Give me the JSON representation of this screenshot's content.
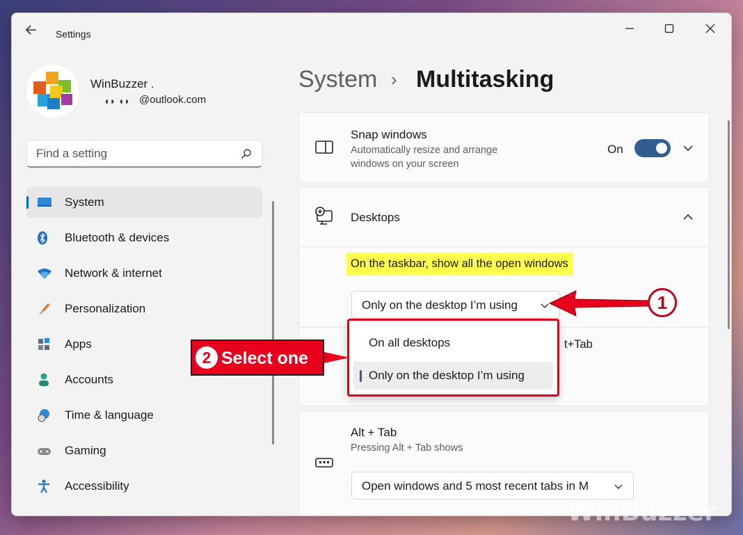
{
  "window": {
    "title": "Settings"
  },
  "user": {
    "name": "WinBuzzer .",
    "email_suffix": "@outlook.com"
  },
  "search": {
    "placeholder": "Find a setting"
  },
  "sidebar": {
    "items": [
      {
        "label": "System",
        "icon": "system-icon",
        "active": true
      },
      {
        "label": "Bluetooth & devices",
        "icon": "bluetooth-icon"
      },
      {
        "label": "Network & internet",
        "icon": "wifi-icon"
      },
      {
        "label": "Personalization",
        "icon": "brush-icon"
      },
      {
        "label": "Apps",
        "icon": "apps-icon"
      },
      {
        "label": "Accounts",
        "icon": "person-icon"
      },
      {
        "label": "Time & language",
        "icon": "clock-globe-icon"
      },
      {
        "label": "Gaming",
        "icon": "gamepad-icon"
      },
      {
        "label": "Accessibility",
        "icon": "accessibility-icon"
      }
    ]
  },
  "breadcrumb": {
    "parent": "System",
    "separator": "›",
    "current": "Multitasking"
  },
  "snap": {
    "title": "Snap windows",
    "desc_line1": "Automatically resize and arrange",
    "desc_line2": "windows on your screen",
    "toggle_label": "On",
    "toggle_on": true
  },
  "desktops": {
    "title": "Desktops",
    "setting_label": "On the taskbar, show all the open windows",
    "dropdown_value": "Only on the desktop I’m using",
    "partial_row_text": "t+Tab",
    "menu_options": [
      "On all desktops",
      "Only on the desktop I’m using"
    ],
    "menu_selected_index": 1
  },
  "alttab": {
    "title": "Alt + Tab",
    "desc": "Pressing Alt + Tab shows",
    "dropdown_value": "Open windows and 5 most recent tabs in M"
  },
  "annotations": {
    "step2_number": "2",
    "step2_text": "Select one",
    "step1_number": "1"
  },
  "watermark": "WinBuzzer",
  "colors": {
    "accent": "#315d91",
    "annotation_red": "#e8001c",
    "highlight": "#ffff4d"
  }
}
